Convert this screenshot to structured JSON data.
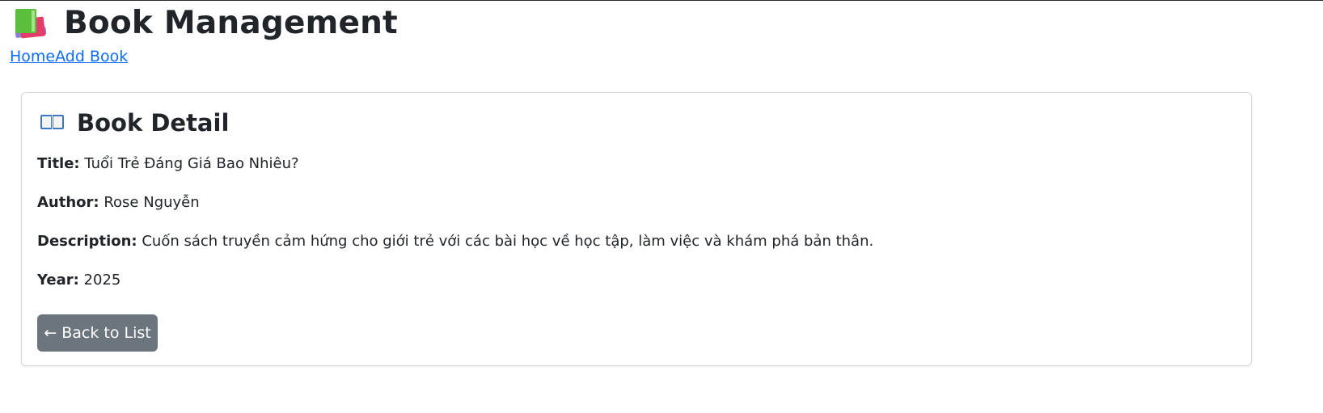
{
  "header": {
    "title": "Book Management",
    "icon": "books-icon"
  },
  "nav": {
    "home_label": "Home",
    "add_book_label": "Add Book"
  },
  "detail": {
    "heading": "Book Detail",
    "heading_icon": "open-book-icon",
    "title_label": "Title:",
    "title_value": "Tuổi Trẻ Đáng Giá Bao Nhiêu?",
    "author_label": "Author:",
    "author_value": "Rose Nguyễn",
    "description_label": "Description:",
    "description_value": "Cuốn sách truyền cảm hứng cho giới trẻ với các bài học về học tập, làm việc và khám phá bản thân.",
    "year_label": "Year:",
    "year_value": "2025",
    "back_button_label": "← Back to List"
  },
  "colors": {
    "link": "#0d6efd",
    "button_secondary": "#6c757d",
    "text": "#212529"
  }
}
